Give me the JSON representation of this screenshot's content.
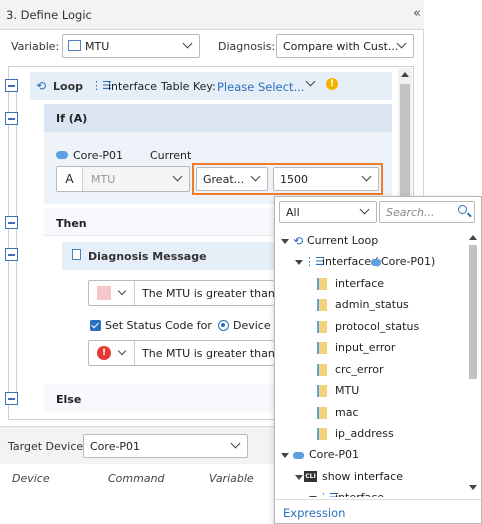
{
  "header": {
    "title": "3. Define Logic",
    "collapse_glyph": "«"
  },
  "variable": {
    "label": "Variable:",
    "value": "MTU"
  },
  "diagnosis": {
    "label": "Diagnosis:",
    "value": "Compare with Cust..."
  },
  "loop": {
    "label": "Loop",
    "target": "interface",
    "table_key_label": "Table Key:",
    "table_key_placeholder": "Please Select..."
  },
  "if_block": {
    "label": "If (A)",
    "device": "Core-P01",
    "current": "Current",
    "operand_letter": "A",
    "operand_value": "MTU",
    "operator": "Great...",
    "compare_value": "1500"
  },
  "then_block": {
    "label": "Then",
    "diagnosis_message": "Diagnosis Message",
    "message_text": "The MTU is greater than",
    "set_status_label": "Set Status Code for",
    "radio_label": "Device",
    "status_message_text": "The MTU is greater than"
  },
  "else_block": {
    "label": "Else"
  },
  "target_device": {
    "label": "Target Device:",
    "value": "Core-P01"
  },
  "table": {
    "columns": [
      "Device",
      "Command",
      "Variable"
    ]
  },
  "popup": {
    "filter_value": "All",
    "search_placeholder": "Search...",
    "items": [
      {
        "label": "Current Loop",
        "level": 0,
        "kind": "loop"
      },
      {
        "label": "interface (",
        "suffix_device": "Core-P01)",
        "level": 1,
        "kind": "table"
      },
      {
        "label": "interface",
        "level": 2,
        "kind": "field"
      },
      {
        "label": "admin_status",
        "level": 2,
        "kind": "field"
      },
      {
        "label": "protocol_status",
        "level": 2,
        "kind": "field"
      },
      {
        "label": "input_error",
        "level": 2,
        "kind": "field"
      },
      {
        "label": "crc_error",
        "level": 2,
        "kind": "field"
      },
      {
        "label": "MTU",
        "level": 2,
        "kind": "field"
      },
      {
        "label": "mac",
        "level": 2,
        "kind": "field"
      },
      {
        "label": "ip_address",
        "level": 2,
        "kind": "field"
      },
      {
        "label": "Core-P01",
        "level": 0,
        "kind": "device"
      },
      {
        "label": "show interface",
        "level": 1,
        "kind": "cli"
      },
      {
        "label": "interface",
        "level": 2,
        "kind": "table"
      }
    ],
    "footer_link": "Expression"
  },
  "colors": {
    "accent": "#2a6fbd",
    "highlight_border": "#f07d2a",
    "row_bg": "#e6eef8",
    "warning": "#f2b400",
    "error": "#e53935"
  }
}
